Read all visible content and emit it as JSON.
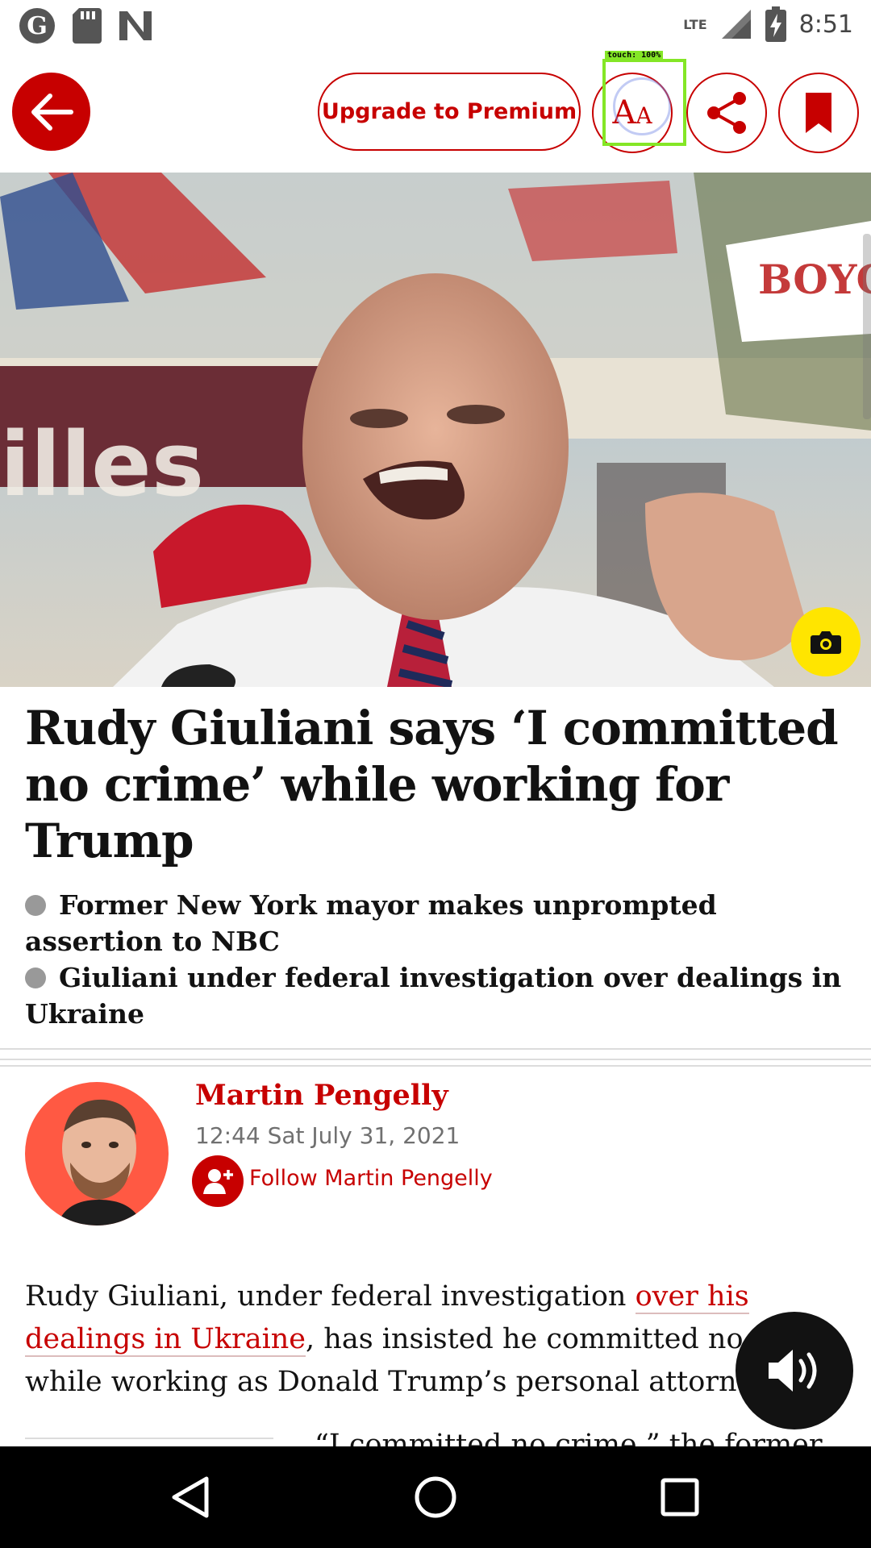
{
  "status_bar": {
    "time": "8:51",
    "network": "LTE",
    "left_icons": [
      "guardian-notification-icon",
      "sd-card-icon",
      "n-notification-icon"
    ],
    "right_icons": [
      "signal-icon",
      "battery-charging-icon"
    ]
  },
  "app_bar": {
    "premium_label": "Upgrade to Premium",
    "text_size_label_large": "A",
    "text_size_label_small": "A",
    "touch_label": "touch: 100%"
  },
  "article": {
    "headline": "Rudy Giuliani says ‘I committed no crime’ while working for Trump",
    "standfirst": [
      "Former New York mayor makes unprompted assertion to NBC",
      "Giuliani under federal investigation over dealings in Ukraine"
    ],
    "byline": {
      "author": "Martin Pengelly",
      "date": "12:44 Sat July 31, 2021",
      "follow_label": "Follow Martin Pengelly"
    },
    "body": {
      "text_before": "Rudy Giuliani, under federal investigation ",
      "link_text": "over his dealings in Ukraine",
      "text_after": ", has insisted he committed no crime while working as Donald Trump’s personal attorney."
    },
    "next_line_peek": "“I committed no crime,” the former"
  },
  "colors": {
    "brand_red": "#c70000",
    "camera_yellow": "#ffe500",
    "avatar_bg": "#ff5943",
    "touch_highlight": "#84e626"
  }
}
